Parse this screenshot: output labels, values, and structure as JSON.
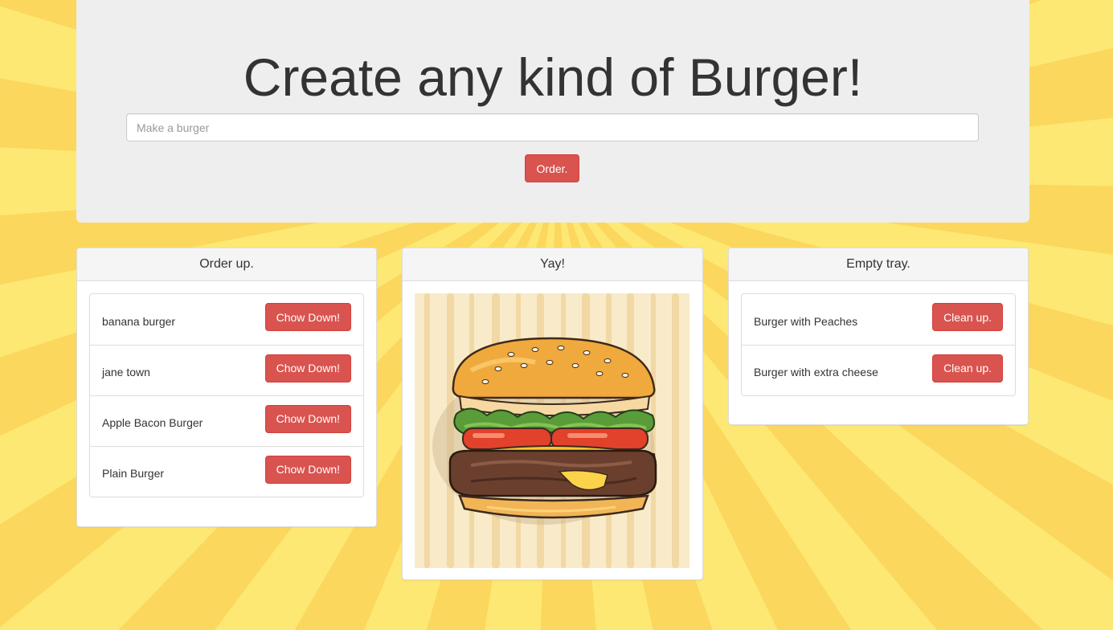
{
  "header": {
    "title": "Create any kind of Burger!",
    "input_placeholder": "Make a burger",
    "input_value": "",
    "order_label": "Order."
  },
  "order_panel": {
    "heading": "Order up.",
    "items": [
      {
        "name": "banana burger",
        "action": "Chow Down!"
      },
      {
        "name": "jane town",
        "action": "Chow Down!"
      },
      {
        "name": "Apple Bacon Burger",
        "action": "Chow Down!"
      },
      {
        "name": "Plain Burger",
        "action": "Chow Down!"
      }
    ]
  },
  "image_panel": {
    "heading": "Yay!",
    "image": "burger-illustration"
  },
  "tray_panel": {
    "heading": "Empty tray.",
    "items": [
      {
        "name": "Burger with Peaches",
        "action": "Clean up."
      },
      {
        "name": "Burger with extra cheese",
        "action": "Clean up."
      }
    ]
  },
  "colors": {
    "danger": "#d9534f",
    "background_light": "#fde873",
    "background_dark": "#fbd75e",
    "jumbotron": "#eeeeee"
  }
}
